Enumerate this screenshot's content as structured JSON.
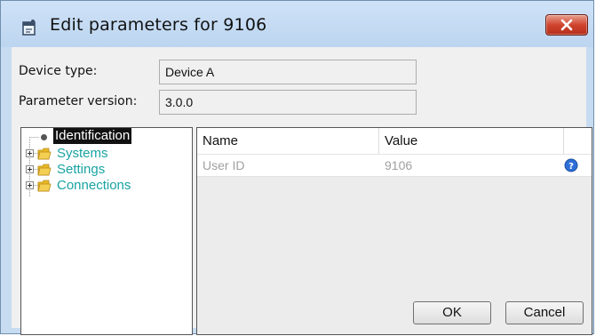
{
  "window": {
    "title": "Edit parameters for 9106",
    "title_icon": "dialog-icon",
    "close_icon": "close-icon"
  },
  "form": {
    "device_type_label": "Device type:",
    "device_type_value": "Device A",
    "param_version_label": "Parameter version:",
    "param_version_value": "3.0.0"
  },
  "tree": {
    "items": [
      {
        "label": "Identification",
        "selected": true,
        "expandable": false
      },
      {
        "label": "Systems",
        "selected": false,
        "expandable": true
      },
      {
        "label": "Settings",
        "selected": false,
        "expandable": true
      },
      {
        "label": "Connections",
        "selected": false,
        "expandable": true
      }
    ]
  },
  "table": {
    "columns": [
      "Name",
      "Value"
    ],
    "rows": [
      {
        "name": "User ID",
        "value": "9106",
        "icon": "help-icon"
      }
    ]
  },
  "buttons": {
    "ok": "OK",
    "cancel": "Cancel"
  },
  "colors": {
    "tree_text": "#1aa3a3",
    "close_button": "#d0442f",
    "help_icon": "#2e6fd6"
  }
}
